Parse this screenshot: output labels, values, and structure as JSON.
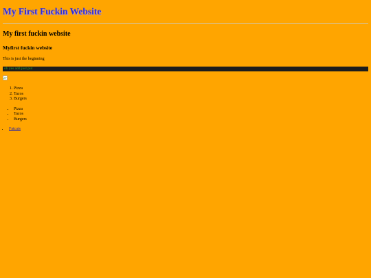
{
  "header": {
    "title": "My First Fuckin Website"
  },
  "main": {
    "heading": "My first fuckin website",
    "subheading": "Myfirst fuckin website",
    "intro": "This is just the beginning",
    "dark_bar_text": "oh yes add just put",
    "image": {
      "icon": "broken-image-icon"
    },
    "ordered_list": [
      "Pizza",
      "Tacos",
      "Burgers"
    ],
    "bullet_list": [
      "Pizza",
      "Tacos",
      "Burgers"
    ],
    "links": [
      "Fatcats"
    ]
  },
  "colors": {
    "background": "#ffa500",
    "title": "#2f2fd9",
    "bar": "#1c1c1c",
    "bar_text": "#2fa02f",
    "link": "#2222aa"
  }
}
